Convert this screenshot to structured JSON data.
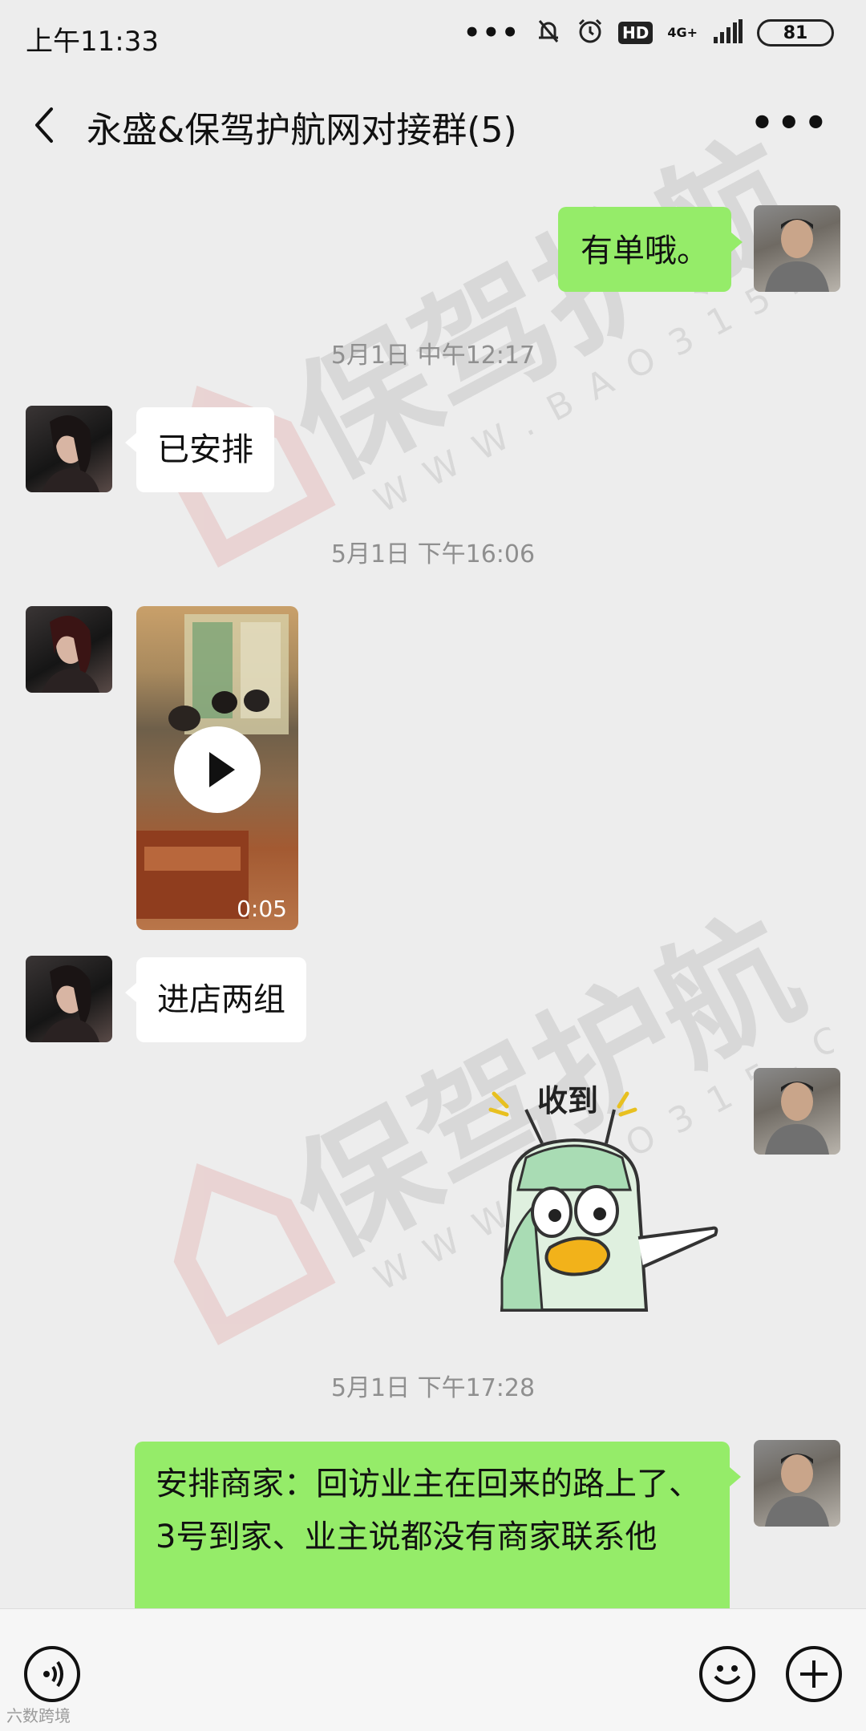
{
  "status_bar": {
    "time": "上午11:33",
    "dots": "•••",
    "hd": "HD",
    "network": "4G+",
    "battery": "81"
  },
  "header": {
    "title": "永盛&保驾护航网对接群(5)",
    "more": "•••"
  },
  "messages": {
    "m1": {
      "sender": "self",
      "text": "有单哦。"
    },
    "t1": "5月1日 中午12:17",
    "m2": {
      "sender": "other",
      "text": "已安排"
    },
    "t2": "5月1日 下午16:06",
    "m3": {
      "sender": "other",
      "type": "video",
      "duration": "0:05"
    },
    "m4": {
      "sender": "other",
      "text": "进店两组"
    },
    "m5": {
      "sender": "self",
      "type": "sticker",
      "text": "收到"
    },
    "t3": "5月1日 下午17:28",
    "m6": {
      "sender": "self",
      "text": "安排商家：回访业主在回来的路上了、3号到家、业主说都没有商家联系他"
    }
  },
  "watermark": {
    "text": "保驾护航",
    "url": "WWW.BAO315.COM"
  },
  "input_bar": {
    "voice_icon": "voice-icon",
    "emoji_icon": "emoji-icon",
    "plus_icon": "plus-icon"
  },
  "footer_mark": "六数跨境",
  "colors": {
    "background": "#ededed",
    "self_bubble": "#95ec69",
    "other_bubble": "#ffffff",
    "timestamp": "#8f8f8f"
  }
}
